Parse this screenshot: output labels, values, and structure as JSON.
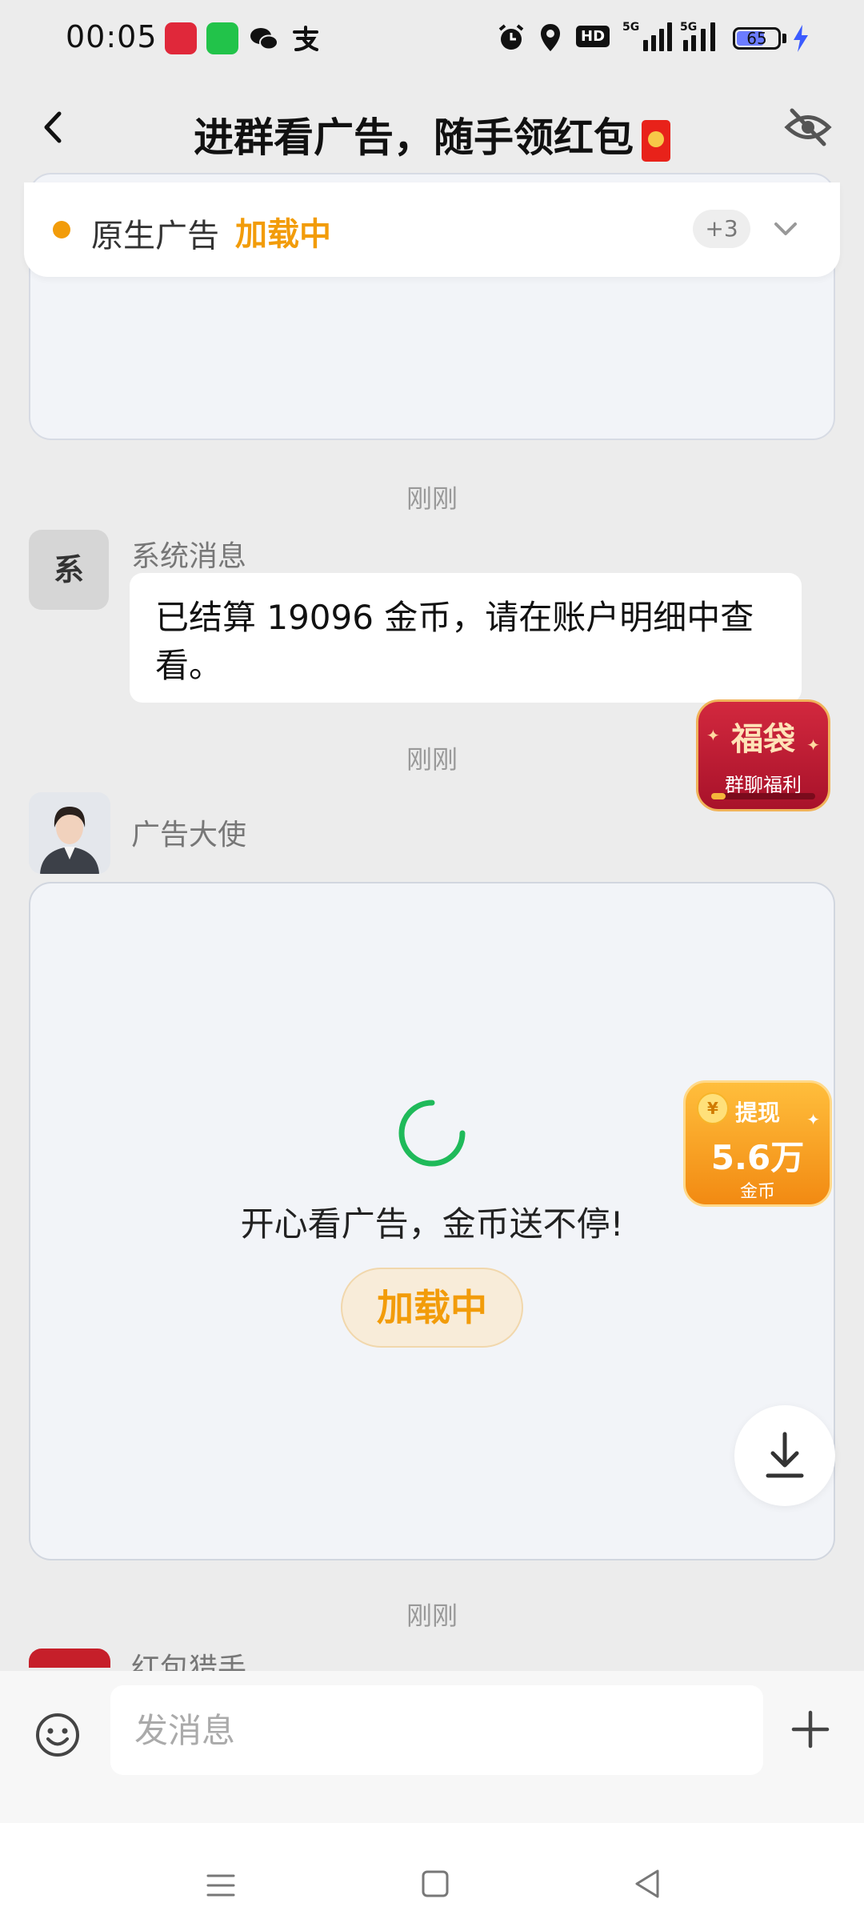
{
  "status_bar": {
    "time": "00:05",
    "hd_label": "HD",
    "signal1_label": "5G",
    "signal2_label": "5G",
    "battery_level": "65",
    "battery_fraction": 0.65
  },
  "header": {
    "title": "进群看广告，随手领红包"
  },
  "ad_notice": {
    "label": "原生广告",
    "status": "加载中",
    "more_count": "+3"
  },
  "chat": {
    "timestamp1": "刚刚",
    "system_avatar_text": "系",
    "system_sender": "系统消息",
    "system_message": "已结算 19096 金币，请在账户明细中查看。",
    "timestamp2": "刚刚",
    "ad_sender": "广告大使",
    "ad_text": "开心看广告，金币送不停!",
    "ad_loading": "加载中",
    "timestamp3": "刚刚",
    "next_sender": "红包猎手"
  },
  "floating": {
    "fudai_title": "福袋",
    "fudai_sub": "群聊福利",
    "withdraw_coin": "¥",
    "withdraw_label": "提现",
    "withdraw_amount": "5.6万",
    "withdraw_unit": "金币"
  },
  "input": {
    "placeholder": "发消息"
  },
  "colors": {
    "accent_orange": "#f29c0a",
    "spinner_green": "#1fba5a",
    "fudai_red": "#c4203a"
  }
}
